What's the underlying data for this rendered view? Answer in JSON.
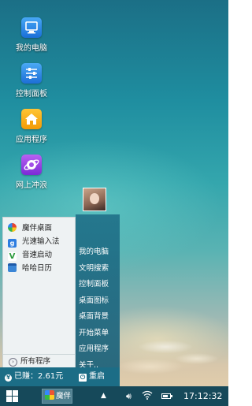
{
  "desktop": {
    "icons": [
      {
        "label": "我的电脑",
        "icon": "computer-icon"
      },
      {
        "label": "控制面板",
        "icon": "control-panel-icon"
      },
      {
        "label": "应用程序",
        "icon": "home-app-icon"
      },
      {
        "label": "网上冲浪",
        "icon": "browser-planet-icon"
      }
    ]
  },
  "start_menu": {
    "apps": [
      {
        "label": "魔伴桌面",
        "icon": "pinwheel-icon"
      },
      {
        "label": "光速输入法",
        "icon": "input-method-icon"
      },
      {
        "label": "音速启动",
        "icon": "v-launcher-icon"
      },
      {
        "label": "哈哈日历",
        "icon": "calendar-icon"
      }
    ],
    "all_programs": "所有程序",
    "right_items": [
      "我的电脑",
      "文明搜索",
      "控制面板",
      "桌面图标",
      "桌面背景",
      "开始菜单",
      "应用程序",
      "关于.."
    ],
    "earned": "已赚：2.61元",
    "restart": "重启"
  },
  "taskbar": {
    "task_label": "魔伴",
    "clock": "17:12:32"
  },
  "colors": {
    "taskbar": "#16495a",
    "menu_right": "#1e6e87",
    "menu_left": "#eef2f3"
  }
}
